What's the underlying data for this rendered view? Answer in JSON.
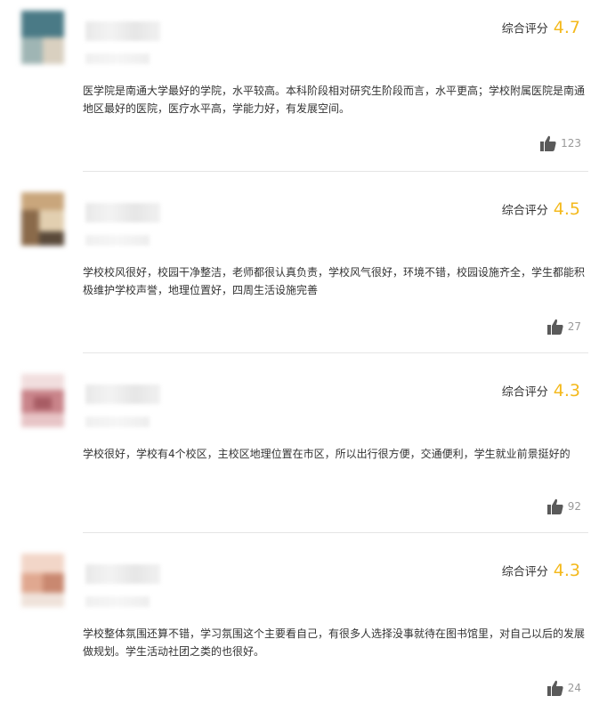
{
  "reviews": [
    {
      "rating_label": "综合评分",
      "score": "4.7",
      "text": "医学院是南通大学最好的学院，水平较高。本科阶段相对研究生阶段而言，水平更高；学校附属医院是南通地区最好的医院，医疗水平高，学能力好，有发展空间。",
      "likes": "123",
      "avatar_colors": [
        "#4a7a86",
        "#9fb5b4",
        "#d9d0c0",
        "#6f8f95"
      ]
    },
    {
      "rating_label": "综合评分",
      "score": "4.5",
      "text": "学校校风很好，校园干净整洁，老师都很认真负责，学校风气很好，环境不错，校园设施齐全，学生都能积极维护学校声誉，地理位置好，四周生活设施完善",
      "likes": "27",
      "avatar_colors": [
        "#8a6a4a",
        "#c9a67c",
        "#5a4a3a",
        "#e2cfb0"
      ]
    },
    {
      "rating_label": "综合评分",
      "score": "4.3",
      "text": "学校很好，学校有4个校区，主校区地理位置在市区，所以出行很方便，交通便利，学生就业前景挺好的",
      "likes": "92",
      "avatar_colors": [
        "#c9848a",
        "#e7c4c6",
        "#a85c64",
        "#f1dede"
      ]
    },
    {
      "rating_label": "综合评分",
      "score": "4.3",
      "text": "学校整体氛围还算不错，学习氛围这个主要看自己，有很多人选择没事就待在图书馆里，对自己以后的发展做规划。学生活动社团之类的也很好。",
      "likes": "24",
      "avatar_colors": [
        "#e0a890",
        "#f2d6c8",
        "#c98870",
        "#efe2da"
      ]
    }
  ],
  "icons": {
    "like": "thumbs-up-icon"
  }
}
